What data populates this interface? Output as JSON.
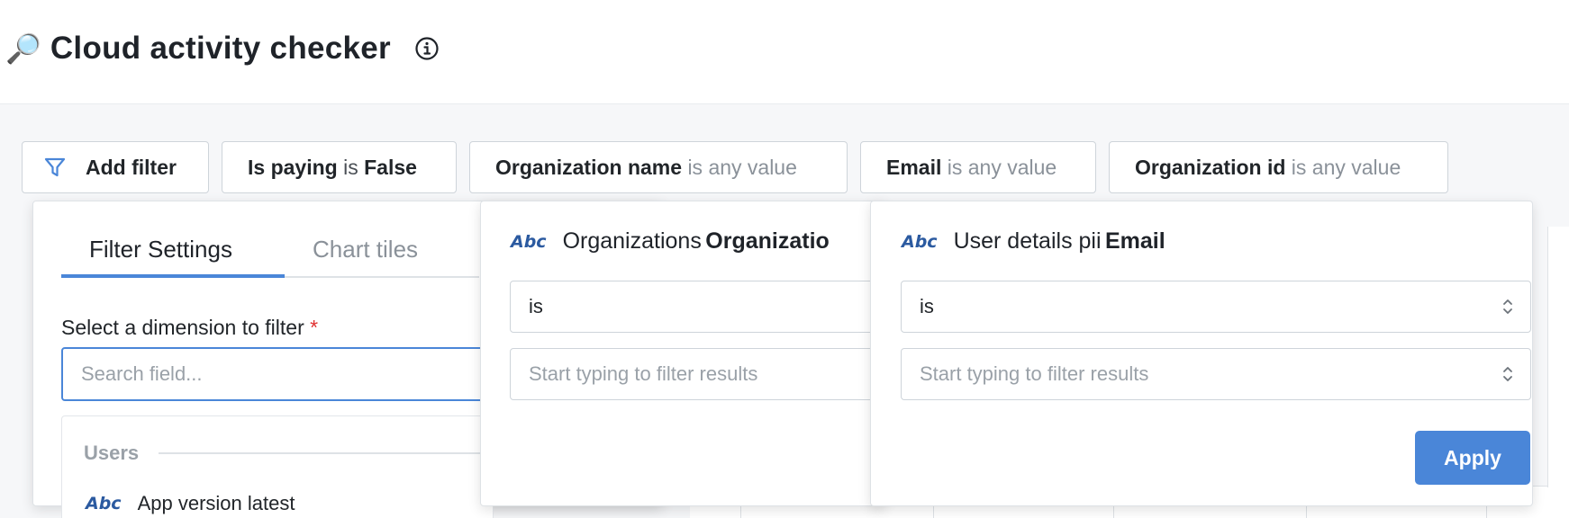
{
  "header": {
    "title_emoji": "🔎",
    "title": "Cloud activity checker",
    "info_icon": "info-circle-icon"
  },
  "filters": {
    "add_filter": {
      "label": "Add filter",
      "icon": "funnel-icon"
    },
    "chips": [
      {
        "field": "Is paying",
        "operator": "is",
        "value": "False"
      },
      {
        "field": "Organization name",
        "operator": "is any value"
      },
      {
        "field": "Email",
        "operator": "is any value"
      },
      {
        "field": "Organization id",
        "operator": "is any value"
      }
    ]
  },
  "add_filter_panel": {
    "tabs": [
      "Filter Settings",
      "Chart tiles"
    ],
    "active_tab": "Filter Settings",
    "dimension_label": "Select a dimension to filter",
    "required_marker": "*",
    "search_placeholder": "Search field...",
    "group_name": "Users",
    "first_item": {
      "type_icon": "Abc",
      "label": "App version latest"
    }
  },
  "org_name_panel": {
    "type_icon": "Abc",
    "table": "Organizations",
    "field": "Organizatio",
    "operator": "is",
    "value_placeholder": "Start typing to filter results"
  },
  "email_panel": {
    "type_icon": "Abc",
    "table": "User details pii",
    "field": "Email",
    "operator": "is",
    "value_placeholder": "Start typing to filter results",
    "apply_label": "Apply"
  },
  "colors": {
    "accent": "#4a86d8",
    "required": "#e03131",
    "type_icon": "#2b5aa0"
  }
}
